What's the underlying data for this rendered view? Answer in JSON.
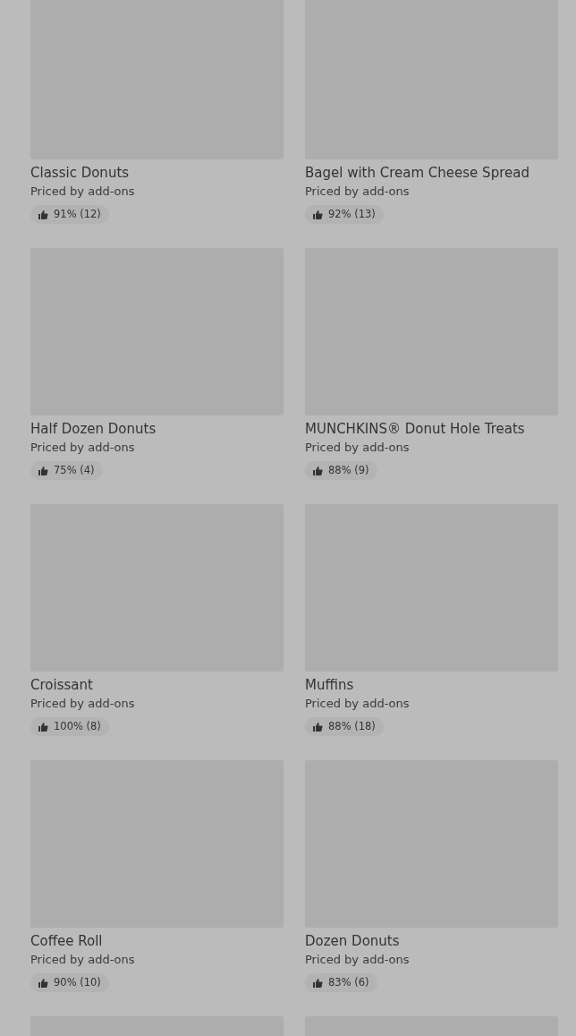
{
  "items": [
    {
      "kind": "product",
      "title": "Classic Donuts",
      "price": "Priced by add-ons",
      "rating": "91% (12)"
    },
    {
      "kind": "product",
      "title": "Bagel with Cream Cheese Spread",
      "price": "Priced by add-ons",
      "rating": "92% (13)"
    },
    {
      "kind": "product",
      "title": "Half Dozen Donuts",
      "price": "Priced by add-ons",
      "rating": "75% (4)"
    },
    {
      "kind": "product",
      "title": "MUNCHKINS® Donut Hole Treats",
      "price": "Priced by add-ons",
      "rating": "88% (9)"
    },
    {
      "kind": "product",
      "title": "Croissant",
      "price": "Priced by add-ons",
      "rating": "100% (8)"
    },
    {
      "kind": "product",
      "title": "Muffins",
      "price": "Priced by add-ons",
      "rating": "88% (18)"
    },
    {
      "kind": "product",
      "title": "Coffee Roll",
      "price": "Priced by add-ons",
      "rating": "90% (10)"
    },
    {
      "kind": "product",
      "title": "Dozen Donuts",
      "price": "Priced by add-ons",
      "rating": "83% (6)"
    },
    {
      "kind": "picture"
    },
    {
      "kind": "picture"
    }
  ]
}
